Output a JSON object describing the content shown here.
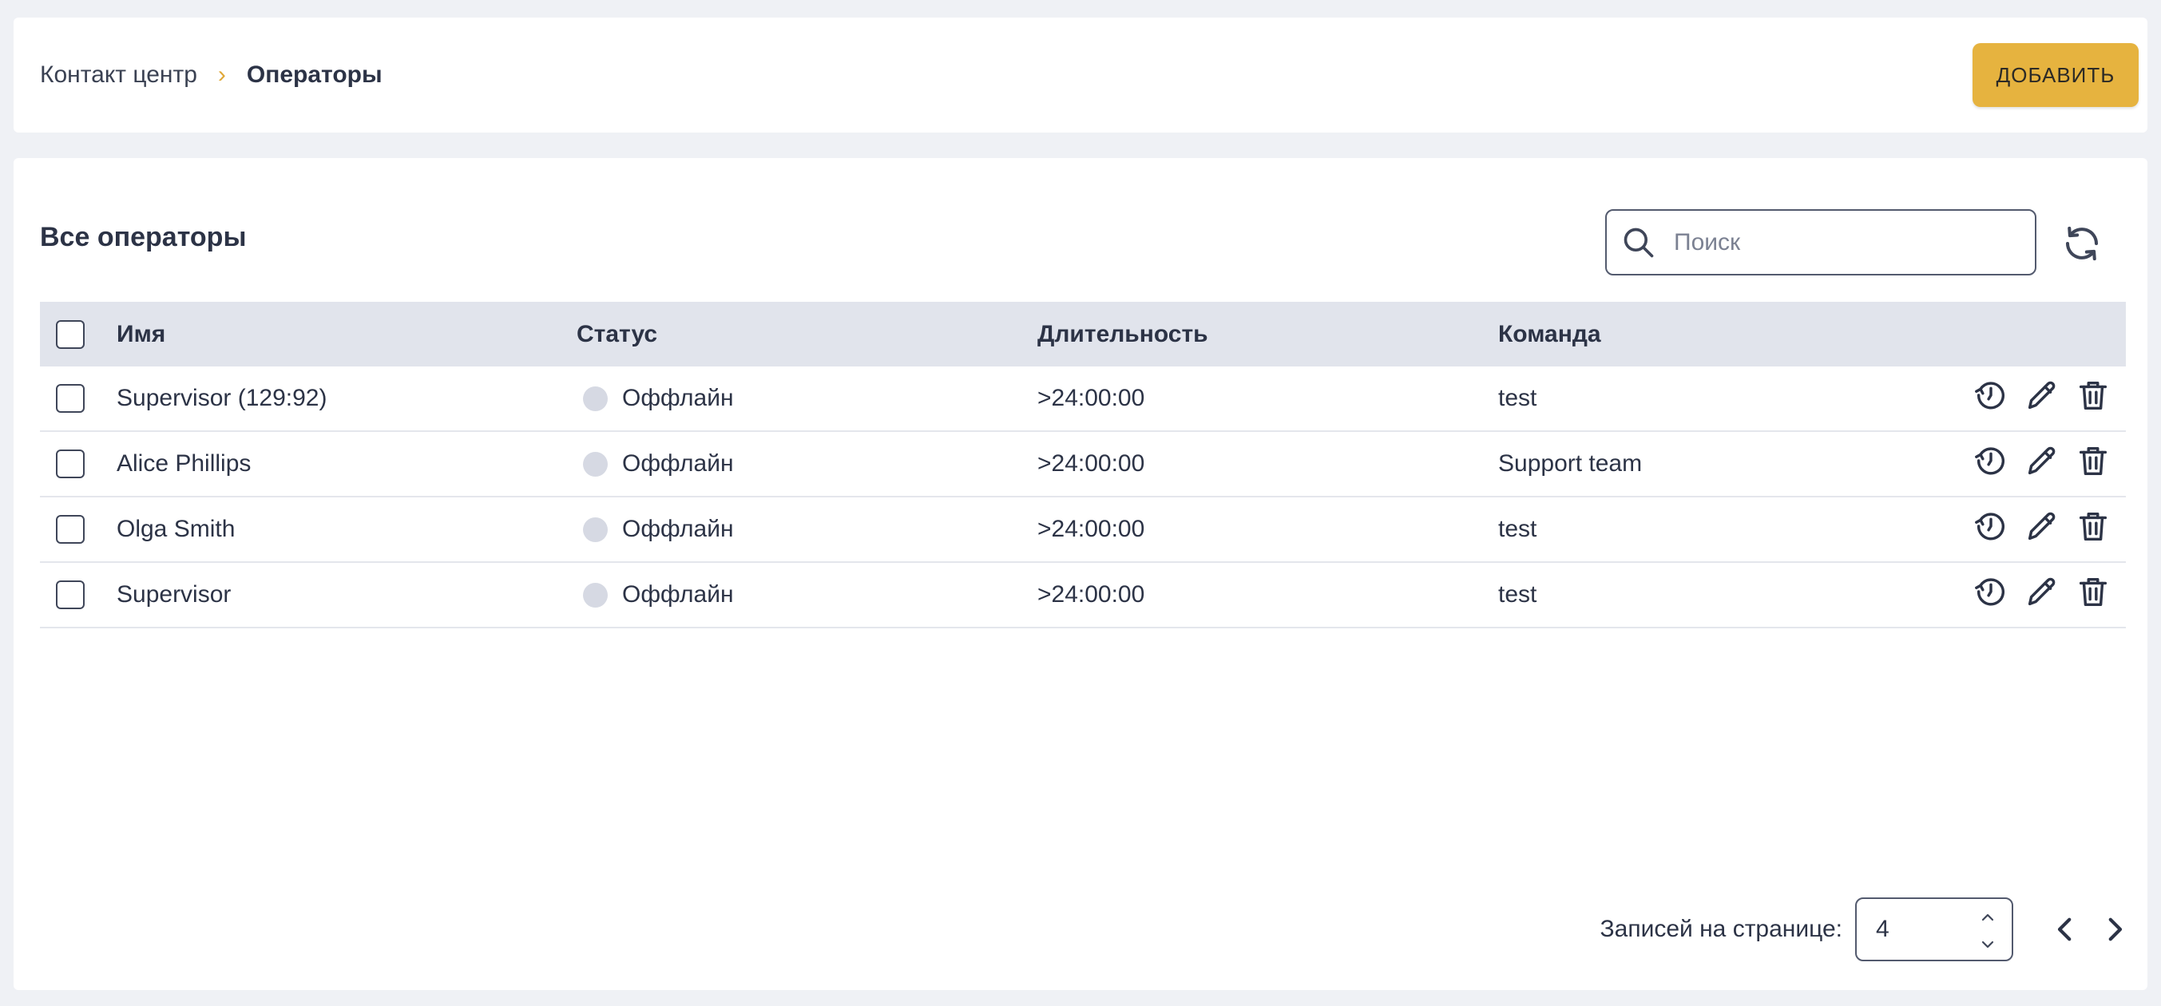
{
  "breadcrumb": {
    "root": "Контакт центр",
    "separator": "›",
    "current": "Операторы"
  },
  "header": {
    "add_button": "ДОБАВИТЬ"
  },
  "panel": {
    "title": "Все операторы"
  },
  "search": {
    "placeholder": "Поиск",
    "value": ""
  },
  "table": {
    "columns": {
      "name": "Имя",
      "status": "Статус",
      "duration": "Длительность",
      "team": "Команда"
    },
    "rows": [
      {
        "name": "Supervisor (129:92)",
        "status": "Оффлайн",
        "duration": ">24:00:00",
        "team": "test"
      },
      {
        "name": "Alice Phillips",
        "status": "Оффлайн",
        "duration": ">24:00:00",
        "team": "Support team"
      },
      {
        "name": "Olga Smith",
        "status": "Оффлайн",
        "duration": ">24:00:00",
        "team": "test"
      },
      {
        "name": "Supervisor",
        "status": "Оффлайн",
        "duration": ">24:00:00",
        "team": "test"
      }
    ],
    "row_actions": [
      "history-icon",
      "pencil-icon",
      "trash-icon"
    ]
  },
  "pagination": {
    "label": "Записей на странице:",
    "per_page": "4"
  },
  "colors": {
    "accent": "#e6b33f",
    "offline_dot": "#d6d9e3",
    "header_bg": "#e1e4ec"
  }
}
